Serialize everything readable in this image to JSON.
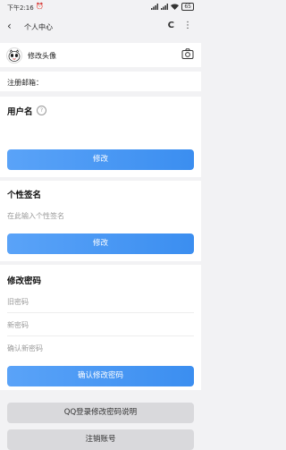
{
  "status_bar": {
    "time": "下午2:16",
    "alarm": "⏰",
    "battery": "65"
  },
  "app_bar": {
    "back_label": "‹",
    "title": "个人中心",
    "reload_label": "C",
    "more_label": "⋮"
  },
  "avatar_section": {
    "label": "修改头像"
  },
  "email_section": {
    "label": "注册邮箱："
  },
  "username_section": {
    "title": "用户名",
    "help": "?",
    "button": "修改"
  },
  "signature_section": {
    "title": "个性签名",
    "placeholder": "在此输入个性签名",
    "button": "修改"
  },
  "password_section": {
    "title": "修改密码",
    "old_placeholder": "旧密码",
    "new_placeholder": "新密码",
    "confirm_placeholder": "确认新密码",
    "button": "确认修改密码"
  },
  "qq_button": "QQ登录修改密码说明",
  "logout_button": "注销账号"
}
